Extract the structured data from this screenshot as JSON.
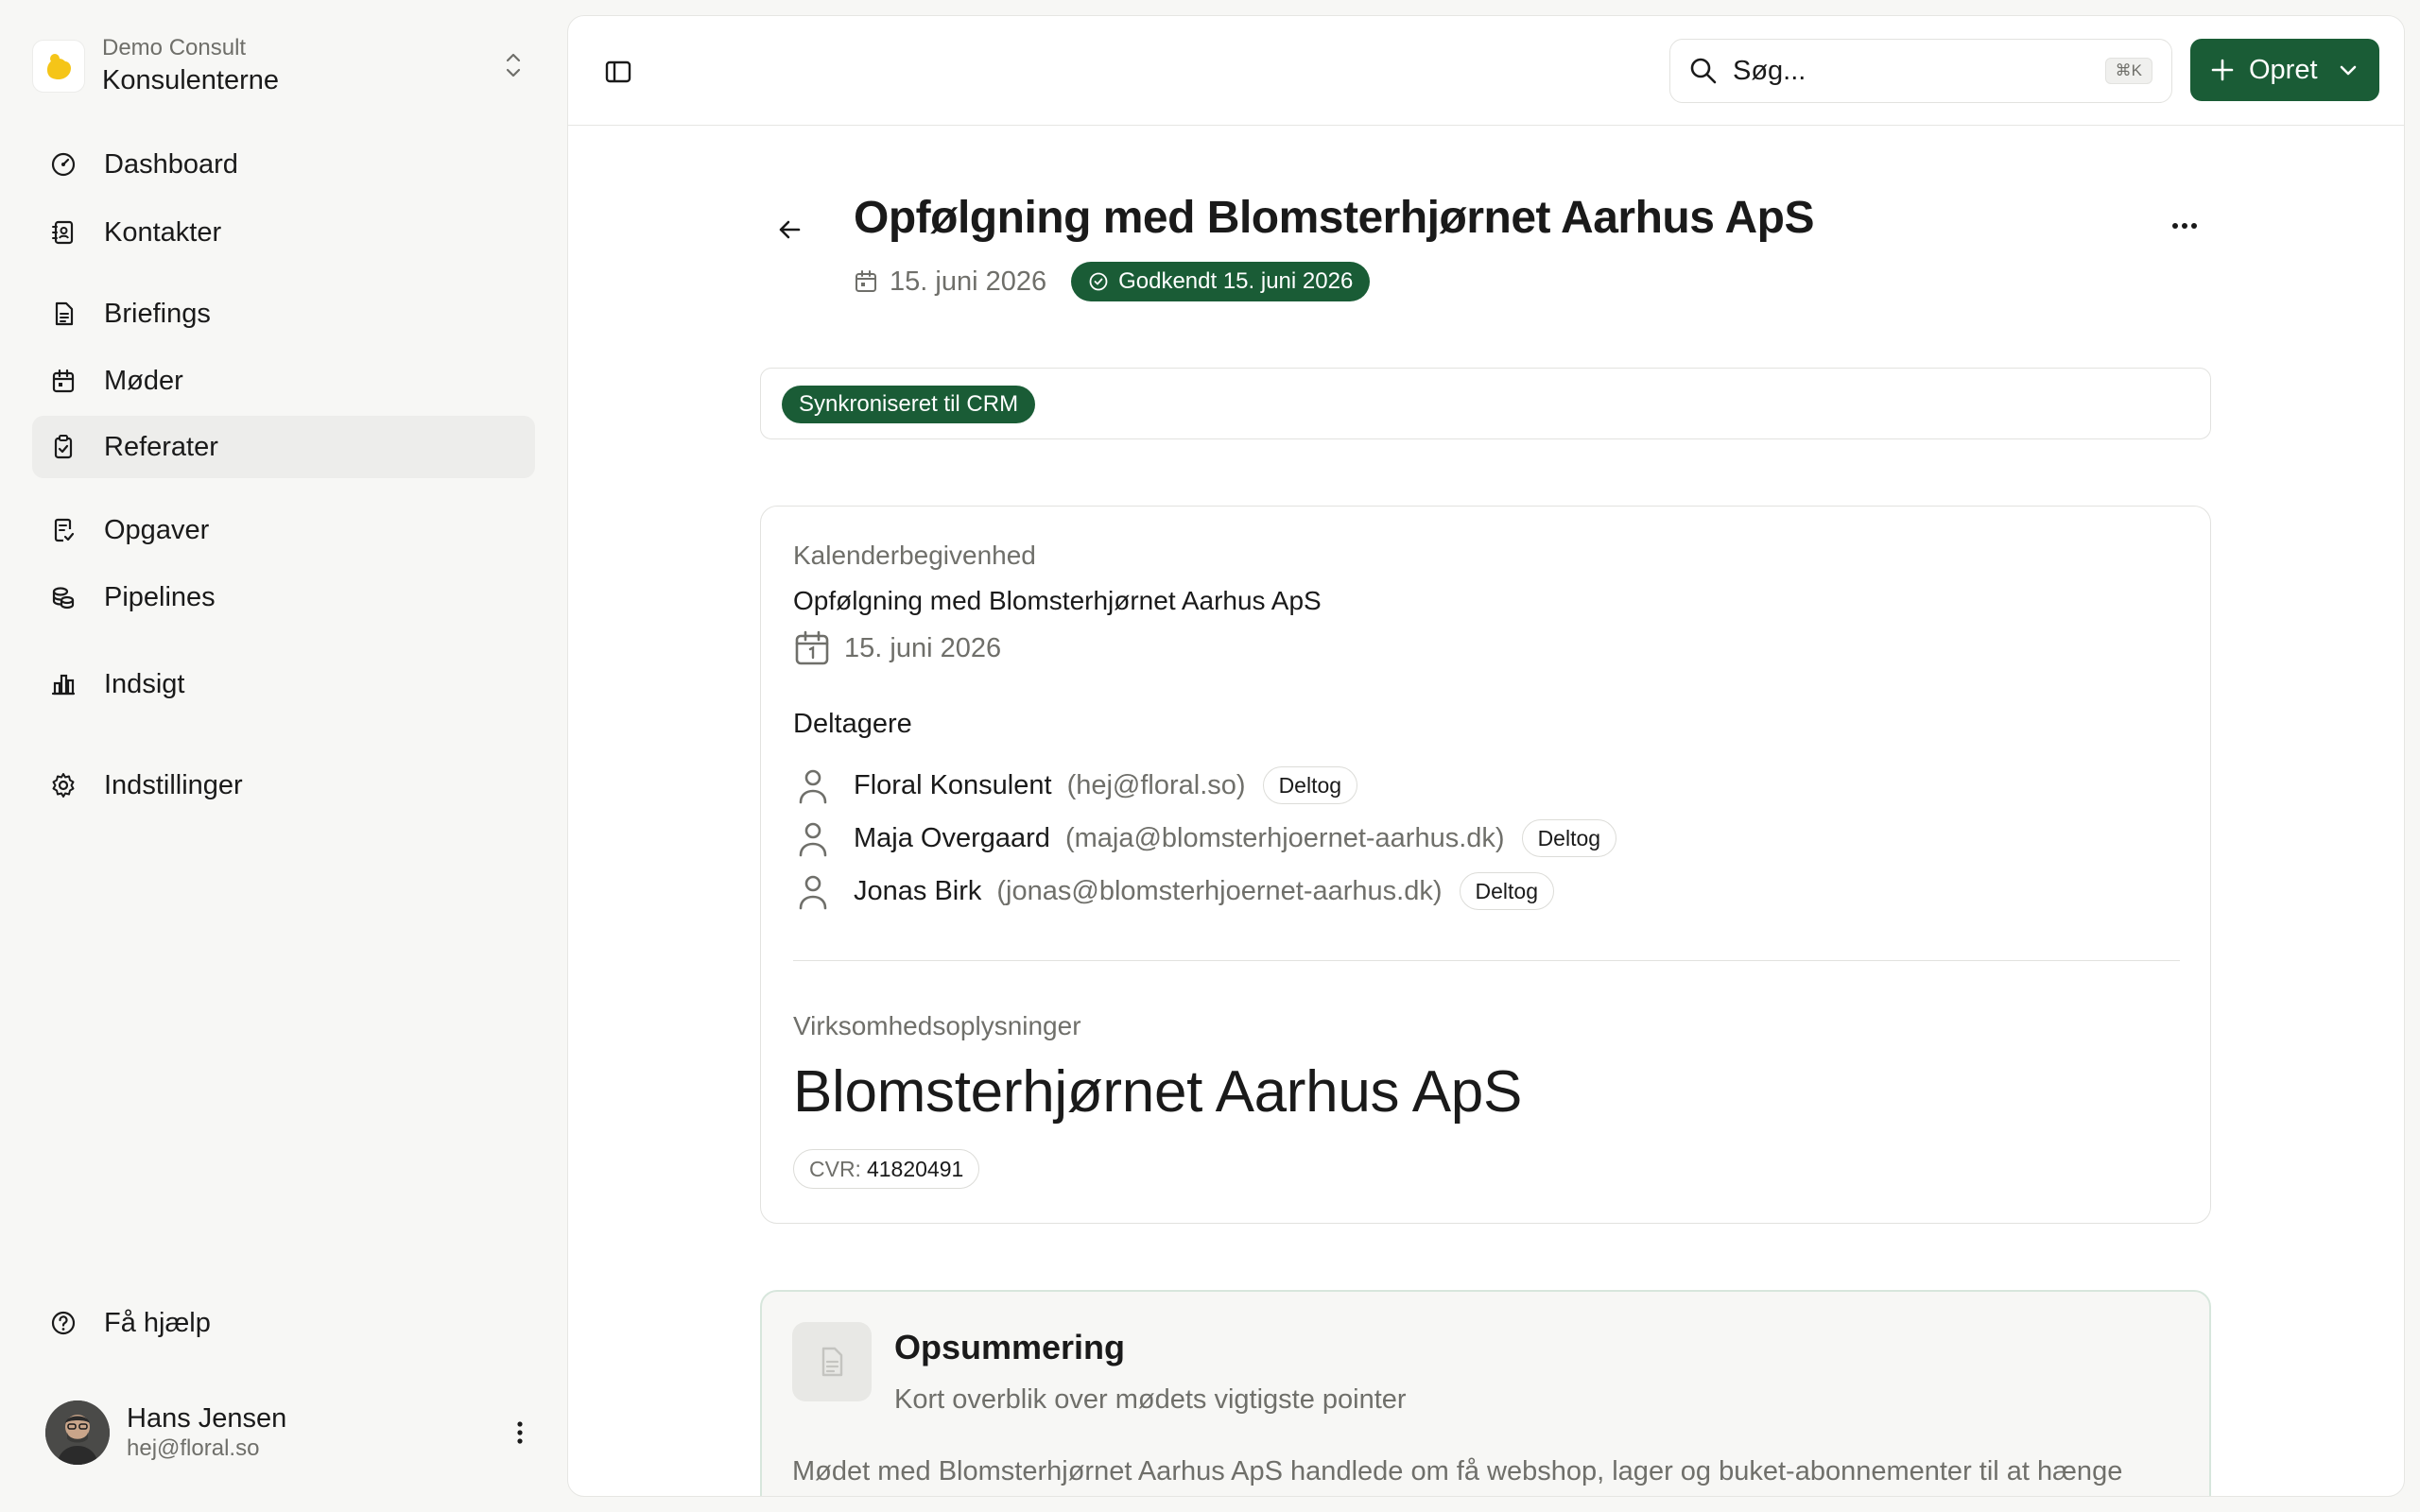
{
  "org": {
    "subtitle": "Demo Consult",
    "name": "Konsulenterne"
  },
  "nav": {
    "dashboard": "Dashboard",
    "contacts": "Kontakter",
    "briefings": "Briefings",
    "meetings": "Møder",
    "minutes": "Referater",
    "tasks": "Opgaver",
    "pipelines": "Pipelines",
    "insights": "Indsigt",
    "settings": "Indstillinger",
    "help": "Få hjælp",
    "active": "Referater"
  },
  "user": {
    "name": "Hans Jensen",
    "email": "hej@floral.so"
  },
  "topbar": {
    "search_label": "Søg...",
    "search_shortcut": "⌘K",
    "create_label": "Opret"
  },
  "meeting": {
    "title": "Opfølgning med Blomsterhjørnet Aarhus ApS",
    "date": "15. juni 2026",
    "approved_badge": "Godkendt 15. juni 2026",
    "sync_badge": "Synkroniseret til CRM"
  },
  "calendar_event": {
    "label": "Kalenderbegivenhed",
    "title": "Opfølgning med Blomsterhjørnet Aarhus ApS",
    "date": "15. juni 2026",
    "participants_heading": "Deltagere",
    "participants": [
      {
        "name": "Floral Konsulent",
        "email": "(hej@floral.so)",
        "status": "Deltog"
      },
      {
        "name": "Maja Overgaard",
        "email": "(maja@blomsterhjoernet-aarhus.dk)",
        "status": "Deltog"
      },
      {
        "name": "Jonas Birk",
        "email": "(jonas@blomsterhjoernet-aarhus.dk)",
        "status": "Deltog"
      }
    ]
  },
  "company": {
    "label": "Virksomhedsoplysninger",
    "name": "Blomsterhjørnet Aarhus ApS",
    "cvr_label": "CVR:",
    "cvr_value": "41820491"
  },
  "summary": {
    "title": "Opsummering",
    "subtitle": "Kort overblik over mødets vigtigste pointer",
    "body": "Mødet med Blomsterhjørnet Aarhus ApS handlede om få webshop, lager og buket-abonnementer til at hænge sammen uden dobbeltarbejde. Parterne blev enige om at holde forløbet meget konkret, fordi de mister margin"
  },
  "colors": {
    "accent": "#1a5c36",
    "muted": "#6f6f6a",
    "sidebar_bg": "#f7f7f5",
    "logo_yellow": "#f5c518"
  },
  "icons": {
    "org_logo": "yellow-blob-logo",
    "org_switch": "chevron-up-down-icon",
    "dashboard": "gauge-icon",
    "contacts": "contact-book-icon",
    "briefings": "document-icon",
    "meetings": "calendar-icon",
    "minutes": "clipboard-check-icon",
    "tasks": "task-list-icon",
    "pipelines": "coins-icon",
    "insights": "bar-chart-icon",
    "settings": "gear-icon",
    "help": "question-circle-icon",
    "sidebar_toggle": "sidebar-panel-icon",
    "search": "search-icon",
    "plus": "plus-icon",
    "back": "arrow-left-icon",
    "more": "ellipsis-icon",
    "participant": "person-icon",
    "summary": "document-icon"
  }
}
